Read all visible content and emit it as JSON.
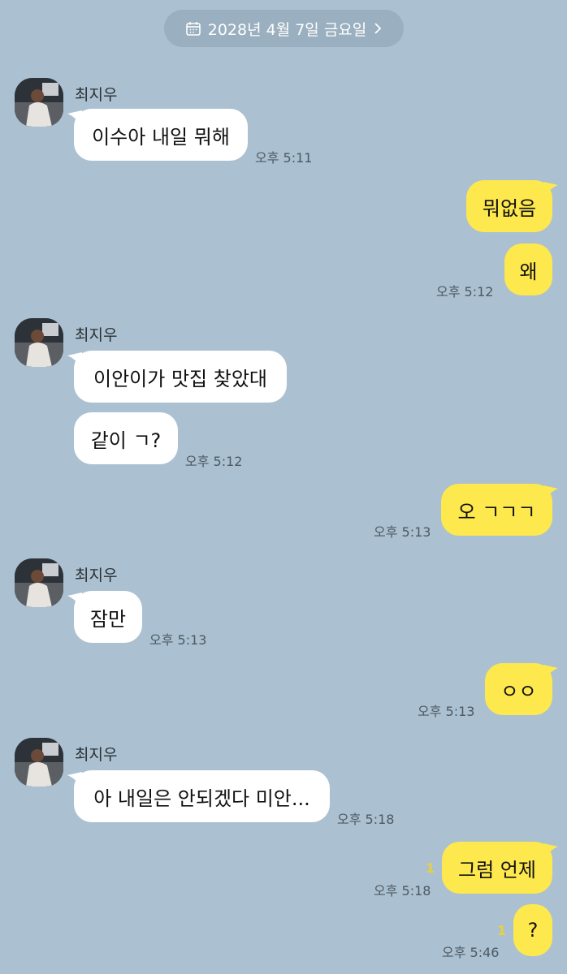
{
  "date_label": "2028년 4월 7일 금요일",
  "colors": {
    "background": "#abc1d1",
    "incoming_bubble": "#ffffff",
    "outgoing_bubble": "#fde84d",
    "unread_count": "#e8d23a"
  },
  "icons": {
    "date": "calendar-icon",
    "date_arrow": "chevron-right-icon"
  },
  "messages": [
    {
      "sender": "최지우",
      "text": "이수아 내일 뭐해",
      "time": "오후 5:11"
    },
    {
      "text": "뭐없음"
    },
    {
      "text": "왜",
      "time": "오후 5:12"
    },
    {
      "sender": "최지우",
      "text": "이안이가 맛집 찾았대"
    },
    {
      "text": "같이 ㄱ?",
      "time": "오후 5:12"
    },
    {
      "text": "오 ㄱㄱㄱ",
      "time": "오후 5:13"
    },
    {
      "sender": "최지우",
      "text": "잠만",
      "time": "오후 5:13"
    },
    {
      "text": "ㅇㅇ",
      "time": "오후 5:13"
    },
    {
      "sender": "최지우",
      "text": "아 내일은 안되겠다 미안...",
      "time": "오후 5:18"
    },
    {
      "text": "그럼 언제",
      "time": "오후 5:18",
      "unread": "1"
    },
    {
      "text": "?",
      "time": "오후 5:46",
      "unread": "1"
    }
  ]
}
